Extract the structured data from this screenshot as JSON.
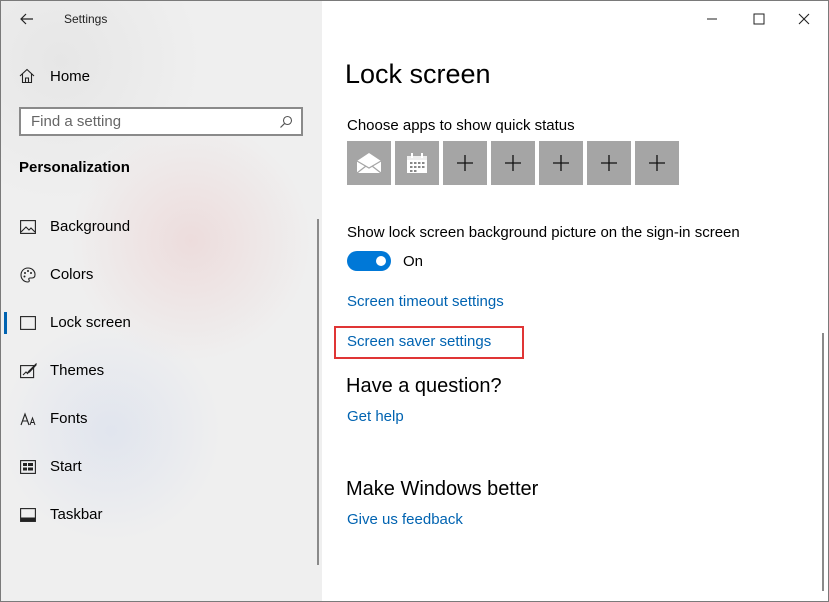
{
  "window": {
    "title": "Settings"
  },
  "sidebar": {
    "home_label": "Home",
    "search": {
      "placeholder": "Find a setting",
      "value": ""
    },
    "section_title": "Personalization",
    "items": [
      {
        "label": "Background",
        "icon": "image-icon",
        "selected": false
      },
      {
        "label": "Colors",
        "icon": "palette-icon",
        "selected": false
      },
      {
        "label": "Lock screen",
        "icon": "lock-screen-icon",
        "selected": true
      },
      {
        "label": "Themes",
        "icon": "themes-icon",
        "selected": false
      },
      {
        "label": "Fonts",
        "icon": "fonts-icon",
        "selected": false
      },
      {
        "label": "Start",
        "icon": "start-icon",
        "selected": false
      },
      {
        "label": "Taskbar",
        "icon": "taskbar-icon",
        "selected": false
      }
    ]
  },
  "main": {
    "title": "Lock screen",
    "quick_status_label": "Choose apps to show quick status",
    "quick_status_tiles": [
      "mail-icon",
      "calendar-icon",
      "plus-icon",
      "plus-icon",
      "plus-icon",
      "plus-icon",
      "plus-icon"
    ],
    "bg_on_signin_label": "Show lock screen background picture on the sign-in screen",
    "toggle_state": "On",
    "screen_timeout_link": "Screen timeout settings",
    "screen_saver_link": "Screen saver settings",
    "question_heading": "Have a question?",
    "get_help_link": "Get help",
    "better_heading": "Make Windows better",
    "feedback_link": "Give us feedback"
  },
  "colors": {
    "accent": "#0078d7",
    "link": "#0063b1",
    "highlight": "#e03535",
    "tile": "#a5a5a5"
  }
}
